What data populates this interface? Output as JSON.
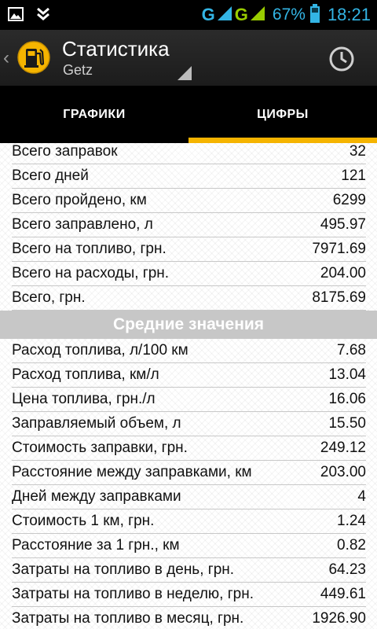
{
  "statusbar": {
    "net1": "G",
    "net2": "G",
    "battery": "67%",
    "time": "18:21",
    "icons": [
      "image-icon",
      "download-icon",
      "signal-icon",
      "signal-icon",
      "battery-icon"
    ]
  },
  "actionbar": {
    "title": "Статистика",
    "subtitle": "Getz",
    "icons": [
      "fuel-pump-icon",
      "clock-icon"
    ]
  },
  "tabs": [
    {
      "label": "ГРАФИКИ",
      "active": false
    },
    {
      "label": "ЦИФРЫ",
      "active": true
    }
  ],
  "totals": [
    {
      "label": "Всего заправок",
      "value": "32"
    },
    {
      "label": "Всего дней",
      "value": "121"
    },
    {
      "label": "Всего пройдено, км",
      "value": "6299"
    },
    {
      "label": "Всего заправлено, л",
      "value": "495.97"
    },
    {
      "label": "Всего на топливо, грн.",
      "value": "7971.69"
    },
    {
      "label": "Всего на расходы, грн.",
      "value": "204.00"
    },
    {
      "label": "Всего, грн.",
      "value": "8175.69"
    }
  ],
  "averages_header": "Средние значения",
  "averages": [
    {
      "label": "Расход топлива, л/100 км",
      "value": "7.68"
    },
    {
      "label": "Расход топлива, км/л",
      "value": "13.04"
    },
    {
      "label": "Цена топлива, грн./л",
      "value": "16.06"
    },
    {
      "label": "Заправляемый объем, л",
      "value": "15.50"
    },
    {
      "label": "Стоимость заправки, грн.",
      "value": "249.12"
    },
    {
      "label": "Расстояние между заправками, км",
      "value": "203.00"
    },
    {
      "label": "Дней между заправками",
      "value": "4"
    },
    {
      "label": "Стоимость 1 км, грн.",
      "value": "1.24"
    },
    {
      "label": "Расстояние за 1 грн., км",
      "value": "0.82"
    },
    {
      "label": "Затраты на топливо в день, грн.",
      "value": "64.23"
    },
    {
      "label": "Затраты на топливо в неделю, грн.",
      "value": "449.61"
    },
    {
      "label": "Затраты на топливо в месяц, грн.",
      "value": "1926.90"
    }
  ],
  "colors": {
    "accent": "#f5b400",
    "status_blue": "#33b5e5",
    "status_green": "#99cc00",
    "section_bg": "#c7c7c7"
  }
}
